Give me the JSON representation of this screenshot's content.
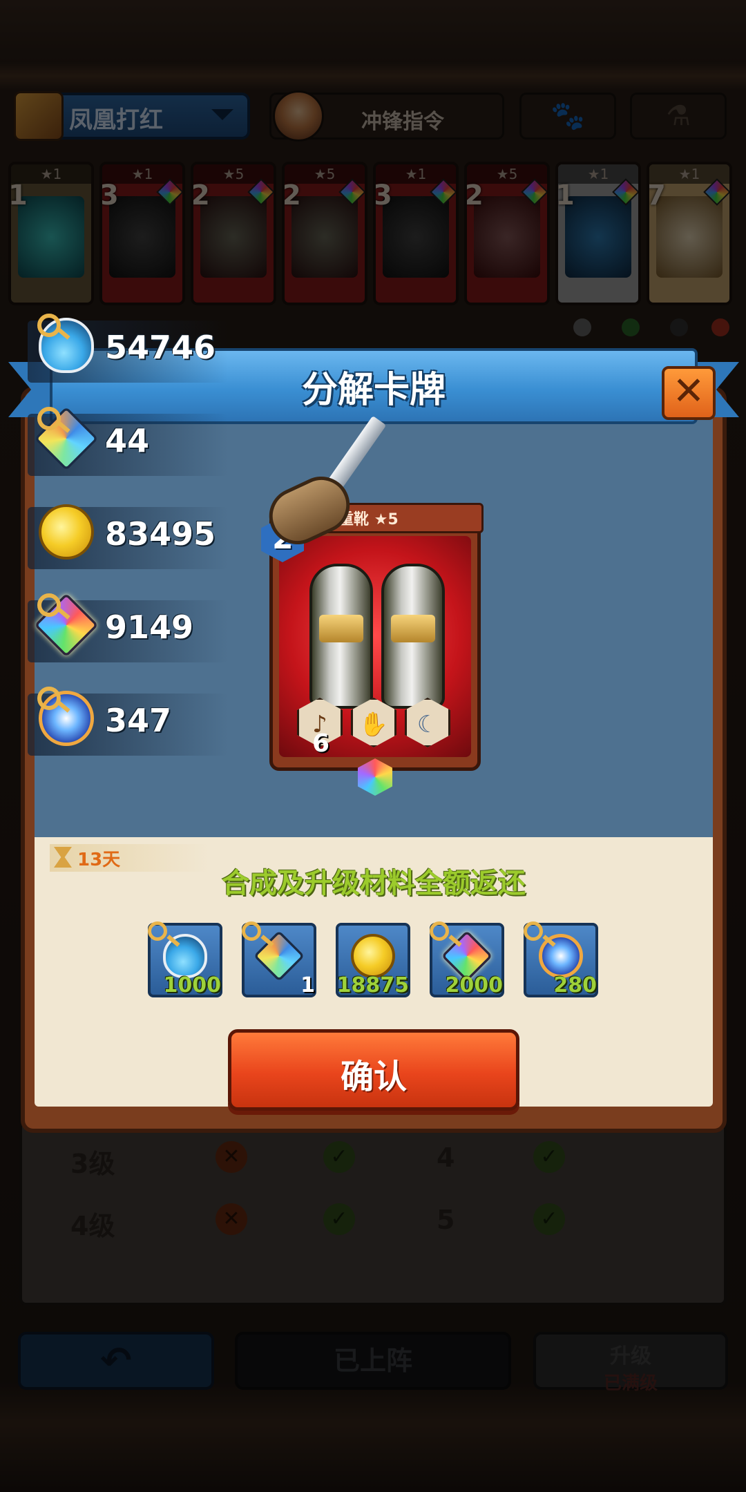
{
  "header": {
    "deck_name": "凤凰打红",
    "hero_button_label": "冲锋指令"
  },
  "card_row": [
    {
      "count": "1",
      "star": "★1"
    },
    {
      "count": "3",
      "star": "★1"
    },
    {
      "count": "2",
      "star": "★5"
    },
    {
      "count": "2",
      "star": "★5"
    },
    {
      "count": "3",
      "star": "★1"
    },
    {
      "count": "2",
      "star": "★5"
    },
    {
      "count": "1",
      "star": "★1"
    },
    {
      "count": "7",
      "star": "★1"
    }
  ],
  "currencies": [
    {
      "icon": "potion-icon",
      "value": "54746"
    },
    {
      "icon": "gem-icon",
      "value": "44"
    },
    {
      "icon": "coin-icon",
      "value": "83495"
    },
    {
      "icon": "rainbow-gem-icon",
      "value": "9149"
    },
    {
      "icon": "orb-icon",
      "value": "347"
    }
  ],
  "modal": {
    "title": "分解卡牌",
    "close_symbol": "✕",
    "card": {
      "name": "重靴 ★5",
      "level": "2",
      "skill_count": "6"
    },
    "timer_text": "13天",
    "refund_text": "合成及升级材料全额返还",
    "rewards": [
      {
        "icon": "potion-icon",
        "amount": "1000"
      },
      {
        "icon": "gem-icon",
        "amount": "1"
      },
      {
        "icon": "coin-icon",
        "amount": "18875"
      },
      {
        "icon": "rainbow-gem-icon",
        "amount": "2000"
      },
      {
        "icon": "orb-icon",
        "amount": "280"
      }
    ],
    "confirm_label": "确认"
  },
  "levels_table": [
    {
      "label": "3级",
      "value": "4"
    },
    {
      "label": "4级",
      "value": "5"
    }
  ],
  "bottom_bar": {
    "back_symbol": "↶",
    "deployed_label": "已上阵",
    "upgrade_label": "升级",
    "upgrade_sub": "已满级"
  }
}
